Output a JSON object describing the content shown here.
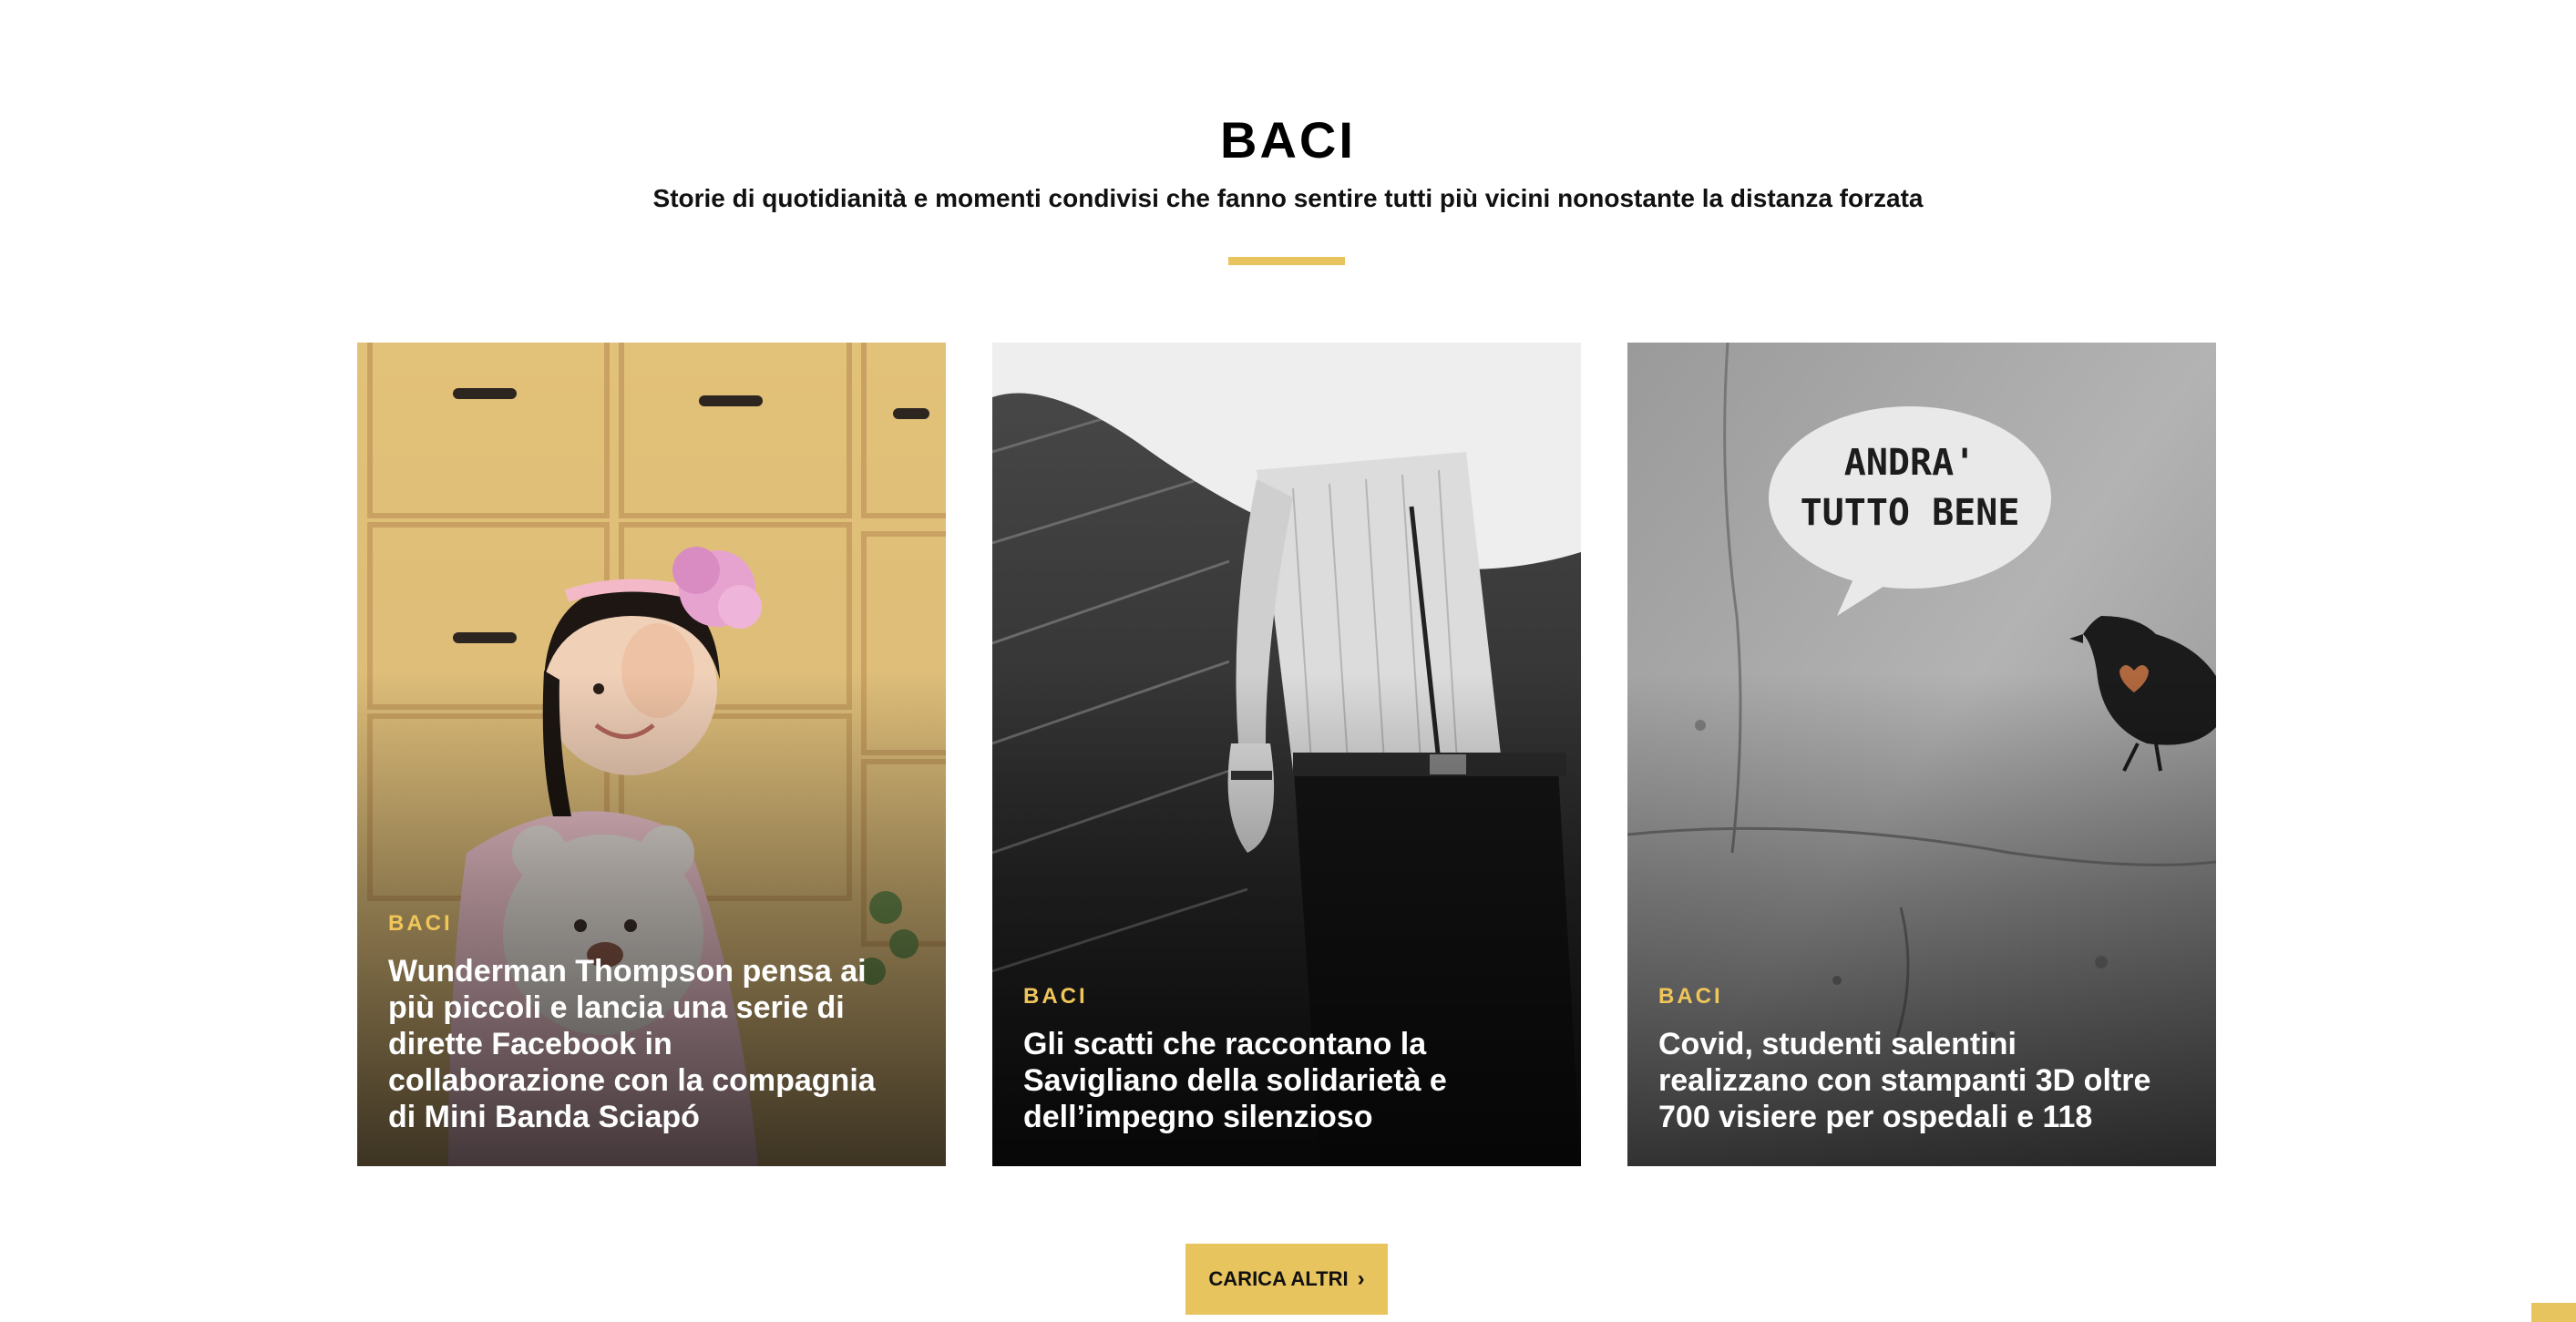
{
  "section": {
    "title": "BACI",
    "subtitle": "Storie di quotidianità e momenti condivisi che fanno sentire tutti più vicini nonostante la distanza forzata"
  },
  "accent_color": "#e8c45f",
  "cards": [
    {
      "category": "BACI",
      "title": "Wunderman Thompson pensa ai più piccoli e lancia una serie di dirette Facebook in collaborazione con la compagnia di Mini Banda Sciapó",
      "image": "girl-with-teddy-bear-photo"
    },
    {
      "category": "BACI",
      "title": "Gli scatti che raccontano la Savigliano della solidarietà e dell’impegno silenzioso",
      "image": "man-in-shirt-black-and-white-photo"
    },
    {
      "category": "BACI",
      "title": "Covid, studenti salentini realizzano con stampanti 3D oltre 700 visiere per ospedali e 118",
      "image": "wall-graffiti-andra-tutto-bene-photo",
      "image_text": "ANDRA' TUTTO BENE"
    }
  ],
  "load_more": {
    "label": "CARICA ALTRI",
    "icon": "chevron-right-icon"
  }
}
